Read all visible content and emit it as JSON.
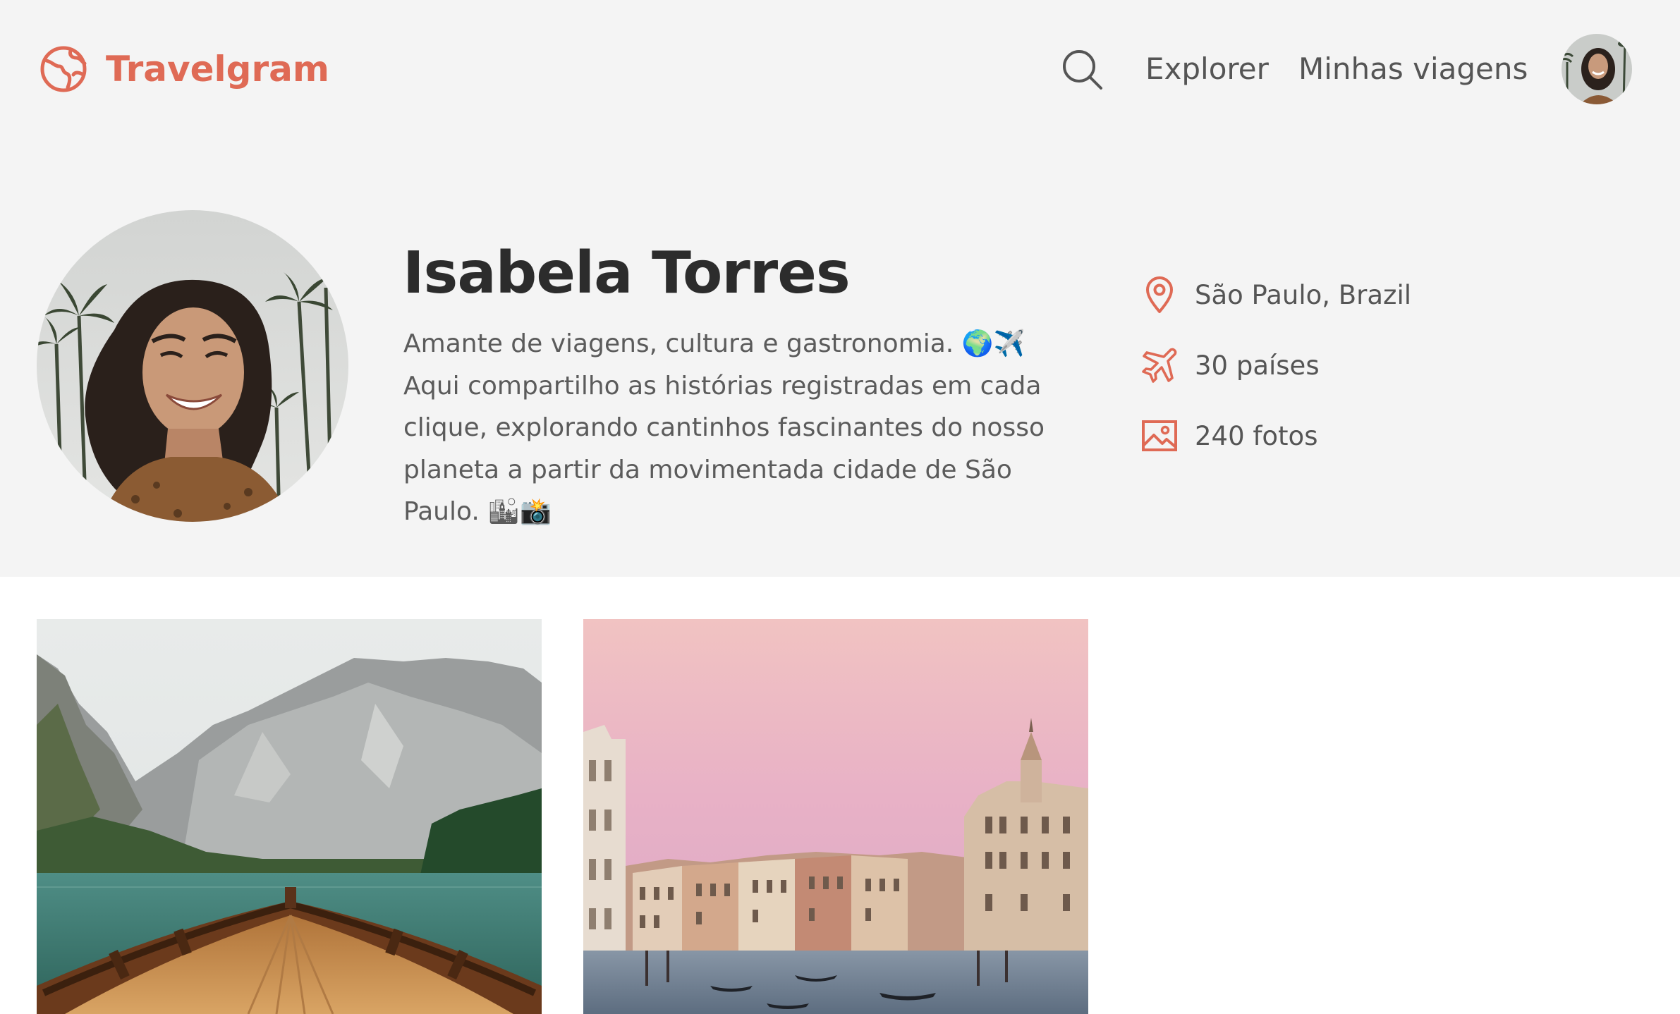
{
  "header": {
    "brand": "Travelgram",
    "logo_icon": "globe-icon",
    "search_icon": "search-icon",
    "nav": [
      {
        "label": "Explorer"
      },
      {
        "label": "Minhas viagens"
      }
    ],
    "avatar": "user-avatar"
  },
  "profile": {
    "name": "Isabela Torres",
    "bio": "Amante de viagens, cultura e gastronomia. 🌍✈️ Aqui compartilho as histórias registradas em cada clique, explorando cantinhos fascinantes do nosso planeta a partir da movimentada cidade de São Paulo. 🏙📸",
    "stats": [
      {
        "icon": "map-pin-icon",
        "text": "São Paulo, Brazil"
      },
      {
        "icon": "airplane-icon",
        "text": "30 países"
      },
      {
        "icon": "image-icon",
        "text": "240 fotos"
      }
    ]
  },
  "gallery": [
    {
      "subject": "mountain-lake-boat-photo"
    },
    {
      "subject": "venice-canal-photo"
    }
  ],
  "colors": {
    "accent": "#df6a55",
    "band_background": "#f4f4f4",
    "page_background": "#ffffff",
    "heading": "#2c2c2c",
    "text": "#5b5b5b"
  }
}
